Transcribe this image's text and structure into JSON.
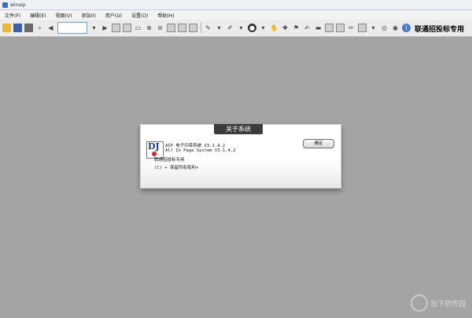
{
  "window": {
    "title": "winaip"
  },
  "menu": [
    "文件(F)",
    "编辑(E)",
    "视图(V)",
    "添加(I)",
    "用户(U)",
    "设置(O)",
    "帮助(H)"
  ],
  "toolbar": {
    "brand": "联通招投标专用"
  },
  "dialog": {
    "title": "关于系统",
    "line1": "AIP 电子印章系统 V3.1.4.2",
    "line2": "All In Page System V3.1.4.2",
    "line3": "联通招投标专用",
    "line4": "(C) + 保留所有权利+",
    "ok_label": "确定",
    "logo_text": "DJ"
  },
  "watermark": "当下软件园"
}
